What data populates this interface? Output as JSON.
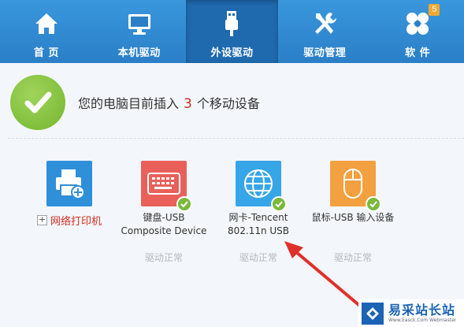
{
  "nav": {
    "items": [
      {
        "label": "首 页",
        "icon": "home-icon"
      },
      {
        "label": "本机驱动",
        "icon": "monitor-icon"
      },
      {
        "label": "外设驱动",
        "icon": "usb-icon",
        "active": true
      },
      {
        "label": "驱动管理",
        "icon": "tools-icon"
      },
      {
        "label": "软 件",
        "icon": "apps-icon",
        "badge": "5"
      }
    ]
  },
  "status": {
    "prefix": "您的电脑目前插入",
    "count": "3",
    "suffix": "个移动设备"
  },
  "devices": [
    {
      "name": "网络打印机",
      "icon": "printer-icon",
      "color": "#2f8fd8",
      "type": "add"
    },
    {
      "name_line1": "键盘-USB",
      "name_line2": "Composite Device",
      "icon": "keyboard-icon",
      "color": "#e9605a",
      "status": "驱动正常"
    },
    {
      "name_line1": "网卡-Tencent",
      "name_line2": "802.11n USB",
      "icon": "globe-icon",
      "color": "#37a6e8",
      "status": "驱动正常"
    },
    {
      "name_line1": "鼠标-USB 输入设备",
      "name_line2": "",
      "icon": "mouse-icon",
      "color": "#f3a040",
      "status": "驱动正常"
    }
  ],
  "watermark": {
    "title": "易采站长站",
    "url": "Www.Easck.Com Webmaster"
  },
  "colors": {
    "nav_bg": "#2a7fc7",
    "nav_active": "#1f6aae",
    "accent_red": "#d62b1e",
    "ok_green": "#7ab93a"
  }
}
